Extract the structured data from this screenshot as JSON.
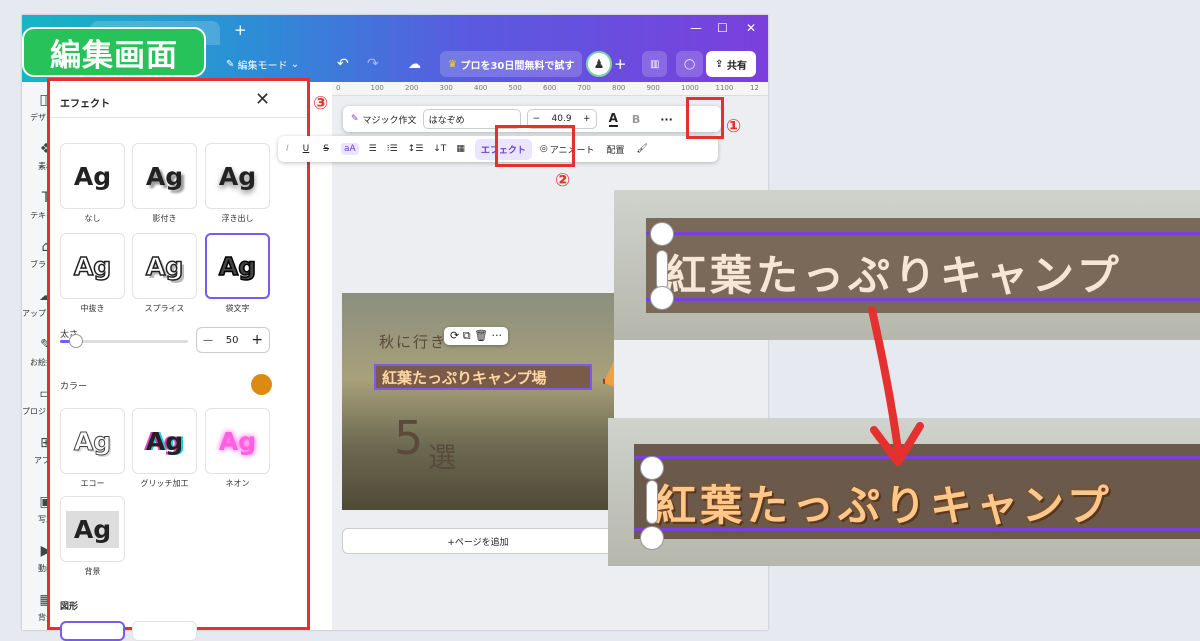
{
  "title_badge": "編集画面",
  "toolbar": {
    "mode_label": "編集モード",
    "promo_label": "プロを30日間無料で試す",
    "share_label": "共有"
  },
  "sidenav": [
    {
      "label": "デザイン",
      "icon": "design-icon"
    },
    {
      "label": "素材",
      "icon": "elements-icon"
    },
    {
      "label": "テキスト",
      "icon": "text-icon"
    },
    {
      "label": "ブランド",
      "icon": "brand-icon"
    },
    {
      "label": "アップロード",
      "icon": "upload-icon"
    },
    {
      "label": "お絵描き",
      "icon": "draw-icon"
    },
    {
      "label": "プロジェクト",
      "icon": "folder-icon"
    },
    {
      "label": "アプリ",
      "icon": "apps-icon"
    },
    {
      "label": "写真",
      "icon": "photo-icon"
    },
    {
      "label": "動画",
      "icon": "video-icon"
    },
    {
      "label": "背景",
      "icon": "background-icon"
    }
  ],
  "panel": {
    "title": "エフェクト",
    "tiles_row1": [
      {
        "text": "Ag",
        "label": "なし"
      },
      {
        "text": "Ag",
        "label": "影付き"
      },
      {
        "text": "Ag",
        "label": "浮き出し"
      }
    ],
    "tiles_row2": [
      {
        "text": "Ag",
        "label": "中抜き"
      },
      {
        "text": "Ag",
        "label": "スプライス"
      },
      {
        "text": "Ag",
        "label": "袋文字"
      }
    ],
    "thickness_label": "太さ",
    "thickness_value": "50",
    "thickness_fraction": 0.5,
    "color_label": "カラー",
    "tiles_row3": [
      {
        "text": "Ag",
        "label": "エコー"
      },
      {
        "text": "Ag",
        "label": "グリッチ加工"
      },
      {
        "text": "Ag",
        "label": "ネオン"
      }
    ],
    "tiles_row4": [
      {
        "text": "Ag",
        "label": "背景"
      }
    ],
    "shape_label": "図形"
  },
  "ruler_ticks": [
    "0",
    "100",
    "200",
    "300",
    "400",
    "500",
    "600",
    "700",
    "800",
    "900",
    "1000",
    "1100",
    "12"
  ],
  "text_toolbar": {
    "magic_label": "マジック作文",
    "font_name": "はなぞめ",
    "font_size": "40.9",
    "effect_label": "エフェクト",
    "animate_label": "アニメート",
    "position_label": "配置"
  },
  "annotations": {
    "one": "①",
    "two": "②",
    "three": "③"
  },
  "design": {
    "subtitle": "秋に行き",
    "title": "紅葉たっぷりキャンプ場",
    "number": "5",
    "unit": "選"
  },
  "add_page_label": "+ページを追加",
  "zoom_text": "紅葉たっぷりキャンプ"
}
